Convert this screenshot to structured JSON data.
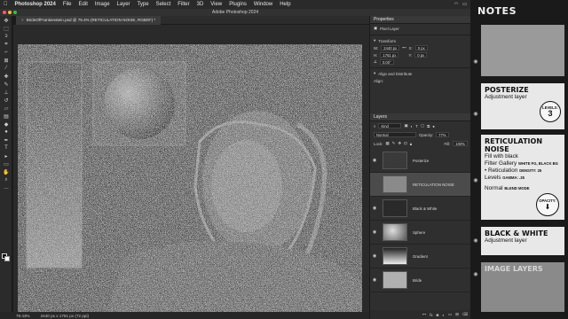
{
  "menubar": {
    "app": "Photoshop 2024",
    "items": [
      "File",
      "Edit",
      "Image",
      "Layer",
      "Type",
      "Select",
      "Filter",
      "3D",
      "View",
      "Plugins",
      "Window",
      "Help"
    ]
  },
  "window_title": "Adobe Photoshop 2024",
  "doc_tab": "BrideOfFrankenstein.psd @ 79.4% (RETICULATION NOISE, RGB/8*) *",
  "status": {
    "zoom": "79.43%",
    "info": "2440 px x 1761 px (72 ppi)"
  },
  "properties": {
    "title": "Properties",
    "kind": "Pixel Layer",
    "transform_label": "Transform",
    "w_label": "W:",
    "w": "2440 px",
    "h_label": "H:",
    "h": "1761 px",
    "x_label": "X:",
    "x": "0 px",
    "y_label": "Y:",
    "y": "0 px",
    "angle": "0.00°",
    "align_label": "Align and Distribute",
    "align_sub": "Align:"
  },
  "layers_panel": {
    "title": "Layers",
    "filter": "Kind",
    "blend": "Normal",
    "opacity_label": "Opacity:",
    "opacity": "77%",
    "lock_label": "Lock:",
    "fill_label": "Fill:",
    "fill": "100%",
    "layers": [
      {
        "name": "Posterize",
        "thumb": "#3a3a3a"
      },
      {
        "name": "RETICULATION NOISE",
        "thumb": "#8a8a8a"
      },
      {
        "name": "Black & White",
        "thumb": "#2a2a2a"
      },
      {
        "name": "Sphere",
        "thumb": "#9a9a9a"
      },
      {
        "name": "Gradient",
        "thumb": "#5a5a5a"
      },
      {
        "name": "Bride",
        "thumb": "#b0b0b0"
      }
    ],
    "fx": "fx"
  },
  "notes": {
    "title": "NOTES",
    "posterize": {
      "title": "POSTERIZE",
      "sub": "Adjustment layer",
      "levels_label": "LEVELS:",
      "levels": "3"
    },
    "reticulation": {
      "title": "RETICULATION NOISE",
      "fill": "Fill with black",
      "filter_gallery": "Filter Gallery",
      "fg_bg": "WHITE FG, BLACK BG",
      "reticulation": "• Reticulation",
      "density": "DENSITY: 25",
      "levels": "Levels",
      "gamma": "GAMMA: .35",
      "normal": "Normal",
      "blend_mode": "BLEND MODE",
      "opacity_label": "OPACITY:",
      "opacity_arrow": "⬇"
    },
    "bw": {
      "title": "BLACK & WHITE",
      "sub": "Adjustment layer"
    },
    "image_layers": {
      "title": "IMAGE LAYERS"
    }
  },
  "colors": {
    "accent": "#e4e4e4",
    "ui_dark": "#2f2f2f",
    "selected": "#4b4b4b"
  }
}
